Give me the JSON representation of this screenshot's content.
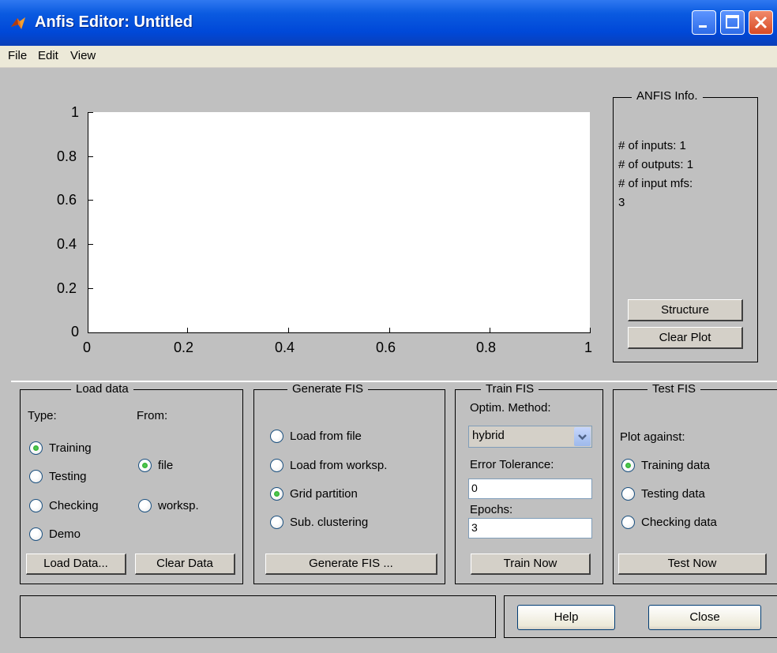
{
  "window": {
    "title": "Anfis Editor: Untitled",
    "title_bar_color": "#0a5ae0"
  },
  "menu": [
    "File",
    "Edit",
    "View"
  ],
  "plot": {
    "y_ticks": [
      "1",
      "0.8",
      "0.6",
      "0.4",
      "0.2",
      "0"
    ],
    "x_ticks": [
      "0",
      "0.2",
      "0.4",
      "0.6",
      "0.8",
      "1"
    ]
  },
  "info": {
    "title": "ANFIS Info.",
    "lines": [
      "# of inputs: 1",
      "# of outputs: 1",
      "# of input mfs:",
      "3"
    ],
    "structure_button": "Structure",
    "clear_plot_button": "Clear Plot"
  },
  "load_data": {
    "title": "Load data",
    "type_label": "Type:",
    "from_label": "From:",
    "types": [
      {
        "label": "Training",
        "selected": true
      },
      {
        "label": "Testing",
        "selected": false
      },
      {
        "label": "Checking",
        "selected": false
      },
      {
        "label": "Demo",
        "selected": false
      }
    ],
    "sources": [
      {
        "label": "file",
        "selected": true
      },
      {
        "label": "worksp.",
        "selected": false
      }
    ],
    "load_button": "Load Data...",
    "clear_button": "Clear Data"
  },
  "generate_fis": {
    "title": "Generate FIS",
    "options": [
      {
        "label": "Load from file",
        "selected": false
      },
      {
        "label": "Load from worksp.",
        "selected": false
      },
      {
        "label": "Grid partition",
        "selected": true
      },
      {
        "label": "Sub. clustering",
        "selected": false
      }
    ],
    "button": "Generate FIS ..."
  },
  "train_fis": {
    "title": "Train FIS",
    "method_label": "Optim. Method:",
    "method_value": "hybrid",
    "error_label": "Error Tolerance:",
    "error_value": "0",
    "epochs_label": "Epochs:",
    "epochs_value": "3",
    "button": "Train Now"
  },
  "test_fis": {
    "title": "Test FIS",
    "plot_against_label": "Plot against:",
    "options": [
      {
        "label": "Training data",
        "selected": true
      },
      {
        "label": "Testing data",
        "selected": false
      },
      {
        "label": "Checking data",
        "selected": false
      }
    ],
    "button": "Test Now"
  },
  "footer": {
    "help_button": "Help",
    "close_button": "Close"
  }
}
